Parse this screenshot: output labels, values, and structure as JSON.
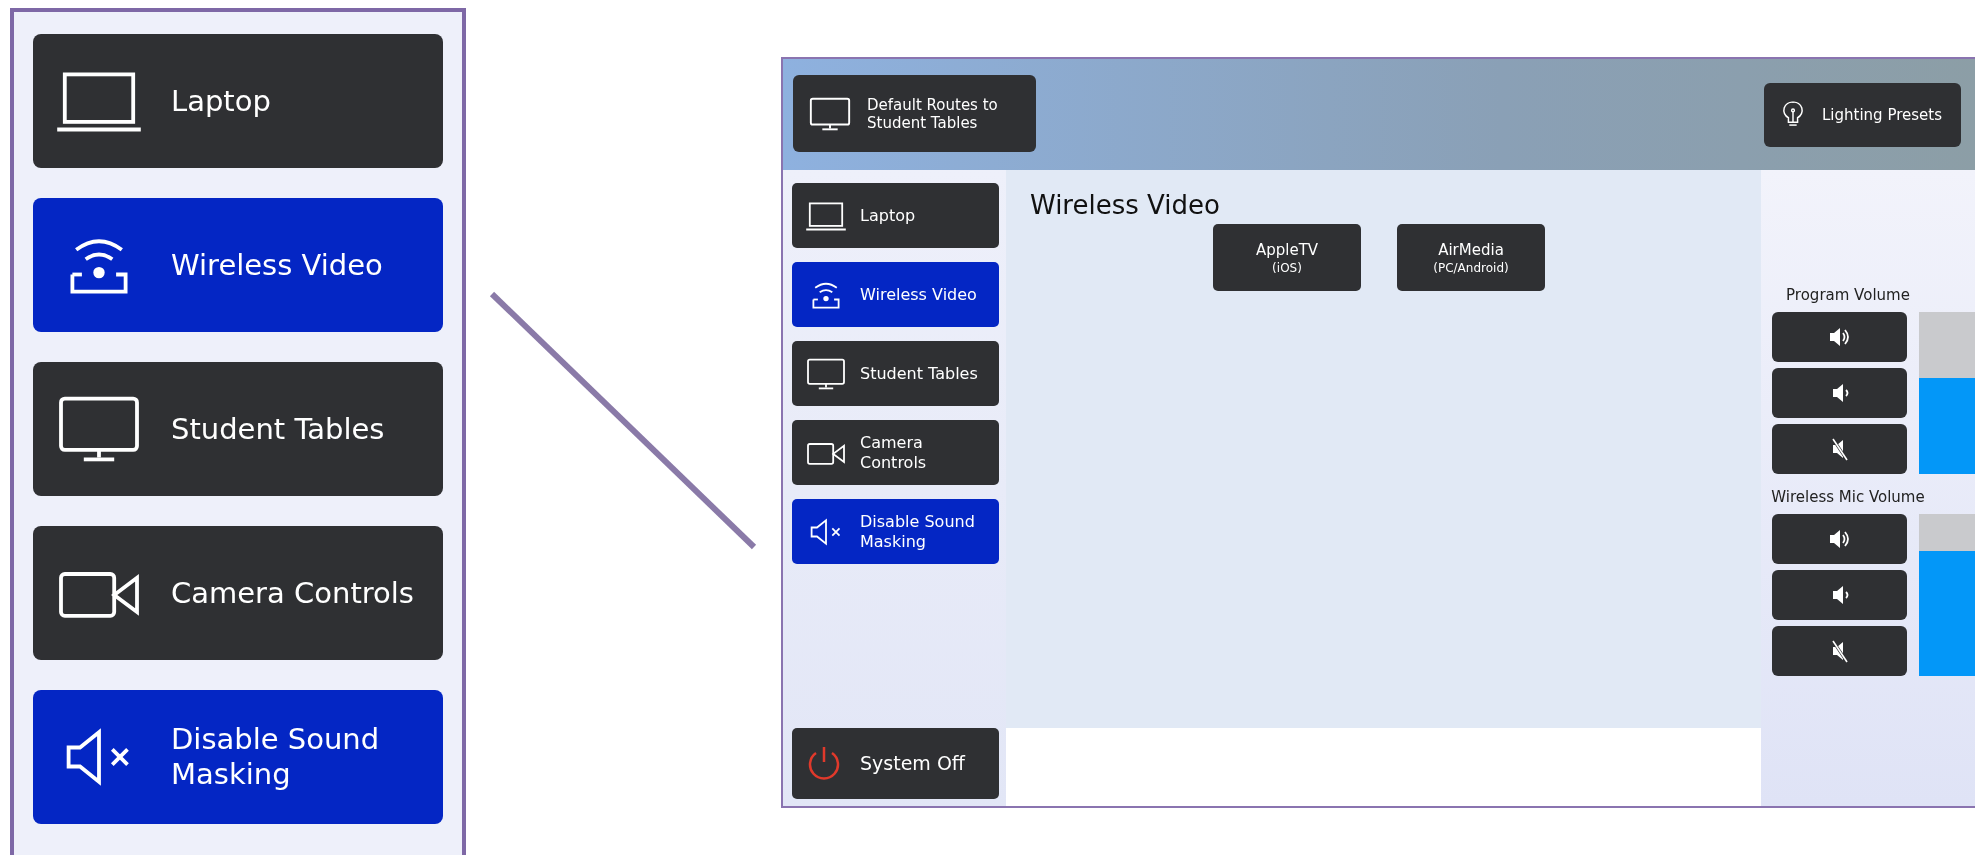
{
  "callout": {
    "items": [
      {
        "label": "Laptop",
        "kind": "laptop",
        "active": false
      },
      {
        "label": "Wireless Video",
        "kind": "wireless",
        "active": true
      },
      {
        "label": "Student Tables",
        "kind": "monitor",
        "active": false
      },
      {
        "label": "Camera Controls",
        "kind": "camera",
        "active": false
      },
      {
        "label": "Disable Sound Masking",
        "kind": "mute",
        "active": true
      }
    ]
  },
  "panel": {
    "header": {
      "routes_button": "Default Routes to Student Tables",
      "lighting_button": "Lighting Presets"
    },
    "sidebar": {
      "items": [
        {
          "label": "Laptop",
          "kind": "laptop",
          "active": false
        },
        {
          "label": "Wireless Video",
          "kind": "wireless",
          "active": true
        },
        {
          "label": "Student Tables",
          "kind": "monitor",
          "active": false
        },
        {
          "label": "Camera Controls",
          "kind": "camera",
          "active": false
        },
        {
          "label": "Disable Sound Masking",
          "kind": "mute",
          "active": true
        }
      ],
      "system_off": "System Off"
    },
    "content": {
      "title": "Wireless Video",
      "sources": [
        {
          "name": "AppleTV",
          "sub": "(iOS)"
        },
        {
          "name": "AirMedia",
          "sub": "(PC/Android)"
        }
      ]
    },
    "volumes": [
      {
        "label": "Program Volume",
        "level": 0.59,
        "buttons": [
          {
            "kind": "up"
          },
          {
            "kind": "down"
          },
          {
            "kind": "mute"
          }
        ]
      },
      {
        "label": "Wireless Mic Volume",
        "level": 0.77,
        "buttons": [
          {
            "kind": "up"
          },
          {
            "kind": "down"
          },
          {
            "kind": "mute"
          }
        ]
      }
    ]
  }
}
